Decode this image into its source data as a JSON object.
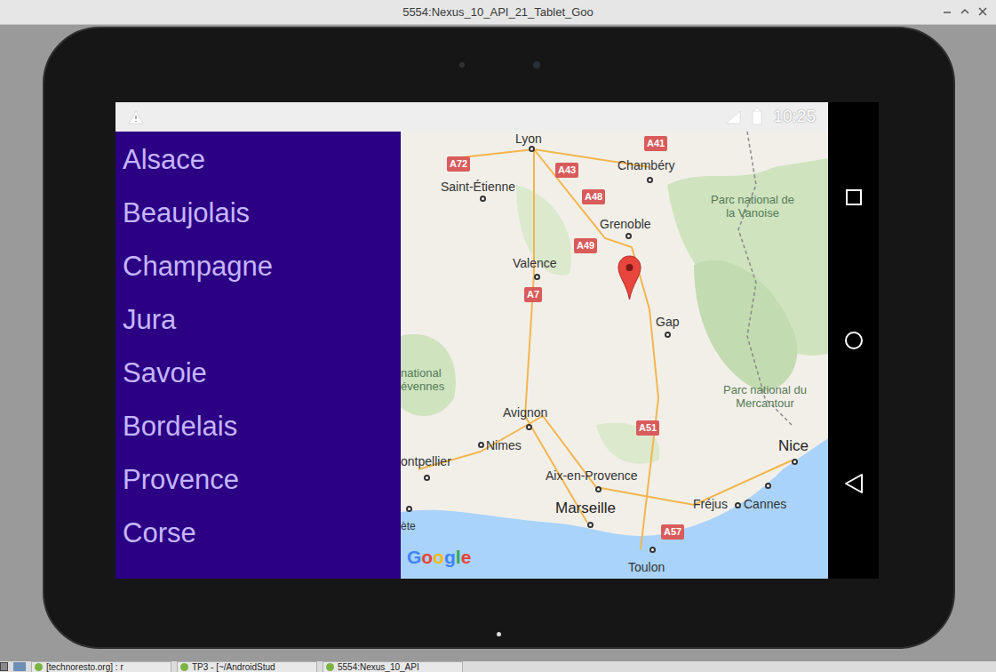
{
  "window": {
    "title": "5554:Nexus_10_API_21_Tablet_Goo"
  },
  "status_bar": {
    "time": "10:25",
    "warning": true
  },
  "regions": [
    {
      "label": "Alsace"
    },
    {
      "label": "Beaujolais"
    },
    {
      "label": "Champagne"
    },
    {
      "label": "Jura"
    },
    {
      "label": "Savoie"
    },
    {
      "label": "Bordelais"
    },
    {
      "label": "Provence"
    },
    {
      "label": "Corse"
    }
  ],
  "map": {
    "labels": [
      {
        "text": "Lyon",
        "kind": "city"
      },
      {
        "text": "A72",
        "kind": "road"
      },
      {
        "text": "A43",
        "kind": "road"
      },
      {
        "text": "A41",
        "kind": "road"
      },
      {
        "text": "Chambéry",
        "kind": "city"
      },
      {
        "text": "Saint-Étienne",
        "kind": "city"
      },
      {
        "text": "A48",
        "kind": "road"
      },
      {
        "text": "Grenoble",
        "kind": "city"
      },
      {
        "text": "Parc national de la Vanoise",
        "kind": "park"
      },
      {
        "text": "A49",
        "kind": "road"
      },
      {
        "text": "Valence",
        "kind": "city"
      },
      {
        "text": "A7",
        "kind": "road"
      },
      {
        "text": "Gap",
        "kind": "city"
      },
      {
        "text": "national évennes",
        "kind": "park-cut"
      },
      {
        "text": "Parc national du Mercantour",
        "kind": "park"
      },
      {
        "text": "Avignon",
        "kind": "city"
      },
      {
        "text": "A51",
        "kind": "road"
      },
      {
        "text": "Nimes",
        "kind": "city"
      },
      {
        "text": "Nice",
        "kind": "city-large"
      },
      {
        "text": "ontpellier",
        "kind": "city"
      },
      {
        "text": "Aix-en-Provence",
        "kind": "city"
      },
      {
        "text": "Marseille",
        "kind": "city-large"
      },
      {
        "text": "Fréjus",
        "kind": "city"
      },
      {
        "text": "Cannes",
        "kind": "city"
      },
      {
        "text": "ète",
        "kind": "city-small"
      },
      {
        "text": "A57",
        "kind": "road"
      },
      {
        "text": "Toulon",
        "kind": "city"
      }
    ],
    "marker": true,
    "logo": "Google"
  },
  "taskbar": {
    "items": [
      {
        "label": "[technoresto.org] : r"
      },
      {
        "label": "TP3 - [~/AndroidStud"
      },
      {
        "label": "5554:Nexus_10_API"
      }
    ]
  }
}
